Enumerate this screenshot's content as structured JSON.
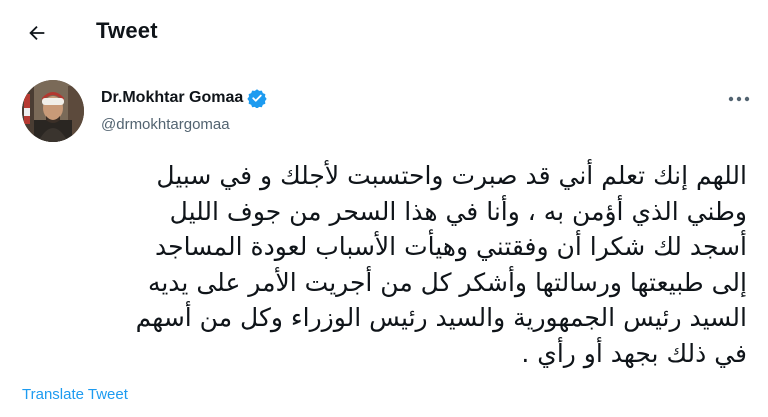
{
  "header": {
    "back_icon": "arrow-left-icon",
    "title": "Tweet"
  },
  "author": {
    "name": "Dr.Mokhtar Gomaa",
    "handle": "@drmokhtargomaa",
    "verified_icon": "verified-badge-icon",
    "more_icon": "more-dots-icon"
  },
  "tweet": {
    "text": "اللهم إنك تعلم أني قد صبرت واحتسبت لأجلك و في سبيل\nوطني الذي أؤمن به ، وأنا في هذا السحر من جوف الليل\nأسجد لك شكرا أن وفقتني وهيأت الأسباب لعودة المساجد\nإلى طبيعتها ورسالتها وأشكر كل من أجريت الأمر على يديه\nالسيد رئيس الجمهورية والسيد رئيس الوزراء وكل من أسهم\nفي ذلك بجهد أو رأي .",
    "translate_label": "Translate Tweet"
  },
  "colors": {
    "text": "#0f1419",
    "secondary": "#536471",
    "accent": "#1d9bf0"
  }
}
